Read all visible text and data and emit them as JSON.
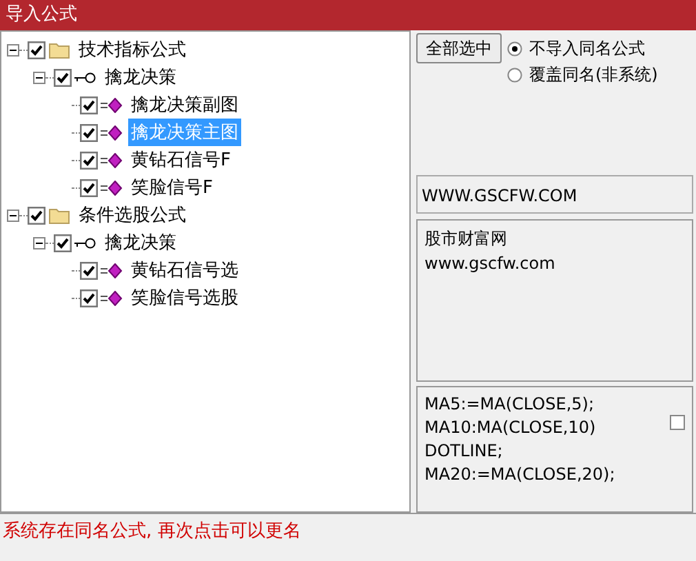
{
  "window": {
    "title": "导入公式"
  },
  "tree": [
    {
      "label": "技术指标公式",
      "kind": "folder",
      "checked": true,
      "expanded": true,
      "selected": false,
      "children": [
        {
          "label": "擒龙决策",
          "kind": "group",
          "checked": true,
          "expanded": true,
          "selected": false,
          "children": [
            {
              "label": "擒龙决策副图",
              "kind": "formula",
              "checked": true,
              "selected": false
            },
            {
              "label": "擒龙决策主图",
              "kind": "formula",
              "checked": true,
              "selected": true
            },
            {
              "label": "黄钻石信号F",
              "kind": "formula",
              "checked": true,
              "selected": false
            },
            {
              "label": "笑脸信号F",
              "kind": "formula",
              "checked": true,
              "selected": false
            }
          ]
        }
      ]
    },
    {
      "label": "条件选股公式",
      "kind": "folder",
      "checked": true,
      "expanded": true,
      "selected": false,
      "children": [
        {
          "label": "擒龙决策",
          "kind": "group",
          "checked": true,
          "expanded": true,
          "selected": false,
          "children": [
            {
              "label": "黄钻石信号选",
              "kind": "formula",
              "checked": true,
              "selected": false
            },
            {
              "label": "笑脸信号选股",
              "kind": "formula",
              "checked": true,
              "selected": false
            }
          ]
        }
      ]
    }
  ],
  "select_all_button": "全部选中",
  "options": [
    {
      "label": "不导入同名公式",
      "selected": true
    },
    {
      "label": "覆盖同名(非系统)",
      "selected": false
    }
  ],
  "url_field": "WWW.GSCFW.COM",
  "description": [
    "股市财富网",
    "www.gscfw.com"
  ],
  "code": {
    "lines": [
      "MA5:=MA(CLOSE,5);",
      "MA10:MA(CLOSE,10)",
      "DOTLINE;",
      "MA20:=MA(CLOSE,20);"
    ],
    "checked": false
  },
  "status_bar": "系统存在同名公式, 再次点击可以更名"
}
